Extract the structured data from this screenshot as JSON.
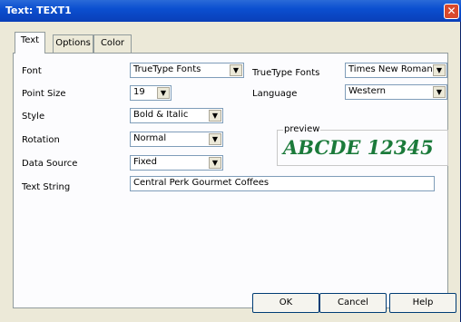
{
  "window": {
    "title": "Text: TEXT1",
    "close_icon": "close-icon"
  },
  "tabs": [
    {
      "label": "Text",
      "active": true
    },
    {
      "label": "Options",
      "active": false
    },
    {
      "label": "Color",
      "active": false
    }
  ],
  "form": {
    "font_label": "Font",
    "font_value": "TrueType Fonts",
    "point_size_label": "Point Size",
    "point_size_value": "19",
    "style_label": "Style",
    "style_value": "Bold & Italic",
    "rotation_label": "Rotation",
    "rotation_value": "Normal",
    "data_source_label": "Data Source",
    "data_source_value": "Fixed",
    "text_string_label": "Text String",
    "text_string_value": "Central Perk Gourmet Coffees",
    "truetype_label": "TrueType Fonts",
    "truetype_value": "Times New Roman",
    "language_label": "Language",
    "language_value": "Western"
  },
  "preview": {
    "label": "preview",
    "text": "ABCDE 12345",
    "text_color": "#1b7a3a"
  },
  "buttons": {
    "ok": "OK",
    "cancel": "Cancel",
    "help": "Help"
  }
}
